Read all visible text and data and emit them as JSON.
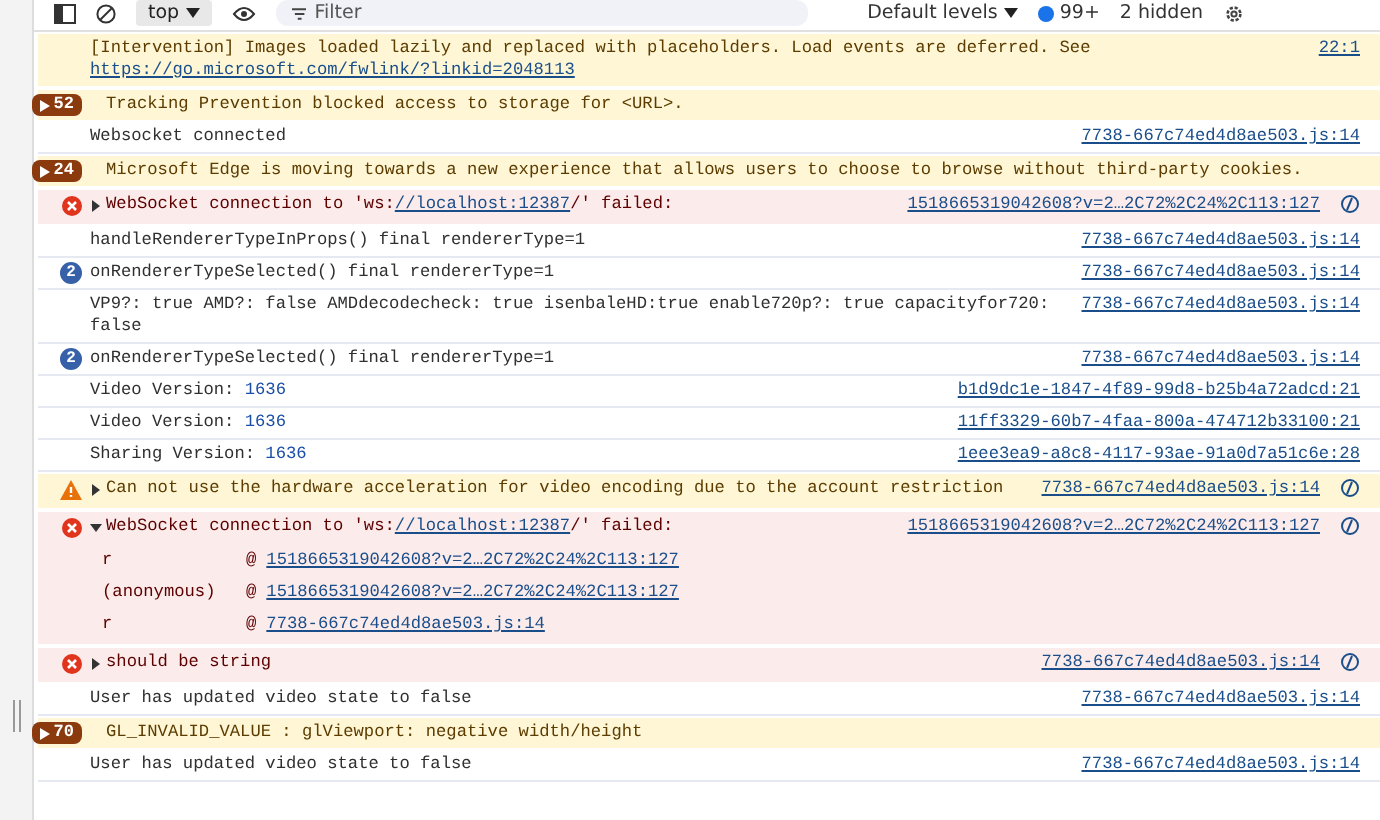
{
  "toolbar": {
    "context": "top",
    "filter": {
      "placeholder": "Filter"
    },
    "levels": "Default levels",
    "issues": "99+",
    "hidden": "2 hidden"
  },
  "messages": [
    {
      "kind": "warning",
      "parts": [
        {
          "kind": "text",
          "text": "[Intervention] Images loaded lazily and replaced with placeholders. Load events are deferred. See"
        },
        {
          "kind": "link_line",
          "text": "https://go.microsoft.com/fwlink/?linkid=2048113"
        }
      ],
      "source": "22:1",
      "insight": false
    },
    {
      "kind": "warning",
      "count": "52",
      "parts": [
        {
          "kind": "text",
          "text": "Tracking Prevention blocked access to storage for <URL>."
        }
      ],
      "insight": false
    },
    {
      "kind": "info",
      "parts": [
        {
          "kind": "text",
          "text": "Websocket connected"
        }
      ],
      "source": "7738-667c74ed4d8ae503.js:14",
      "insight": false
    },
    {
      "kind": "warning",
      "count": "24",
      "parts": [
        {
          "kind": "text",
          "text": "Microsoft Edge is moving towards a new experience that allows users to choose to browse without third-party cookies."
        }
      ],
      "insight": false
    },
    {
      "kind": "error",
      "expanded": false,
      "parts": [
        {
          "kind": "text",
          "text": "WebSocket connection to 'ws:"
        },
        {
          "kind": "link",
          "text": "//localhost:12387"
        },
        {
          "kind": "text",
          "text": "/' failed:"
        }
      ],
      "source": "1518665319042608?v=2…2C72%2C24%2C113:127",
      "insight": true
    },
    {
      "kind": "info",
      "parts": [
        {
          "kind": "text",
          "text": "handleRendererTypeInProps() final rendererType=1"
        }
      ],
      "source": "7738-667c74ed4d8ae503.js:14",
      "insight": false
    },
    {
      "kind": "info",
      "repeat": "2",
      "parts": [
        {
          "kind": "text",
          "text": "onRendererTypeSelected() final rendererType=1"
        }
      ],
      "source": "7738-667c74ed4d8ae503.js:14",
      "insight": false
    },
    {
      "kind": "info",
      "parts": [
        {
          "kind": "text",
          "text": "VP9?: true AMD?: false AMDdecodecheck: true isenbaleHD:true enable720p?: true capacityfor720: false"
        }
      ],
      "source": "7738-667c74ed4d8ae503.js:14",
      "insight": false
    },
    {
      "kind": "info",
      "repeat": "2",
      "parts": [
        {
          "kind": "text",
          "text": "onRendererTypeSelected() final rendererType=1"
        }
      ],
      "source": "7738-667c74ed4d8ae503.js:14",
      "insight": false
    },
    {
      "kind": "info",
      "parts": [
        {
          "kind": "text",
          "text": "Video Version: "
        },
        {
          "kind": "number",
          "text": "1636"
        }
      ],
      "source": "b1d9dc1e-1847-4f89-99d8-b25b4a72adcd:21",
      "insight": false
    },
    {
      "kind": "info",
      "parts": [
        {
          "kind": "text",
          "text": "Video Version: "
        },
        {
          "kind": "number",
          "text": "1636"
        }
      ],
      "source": "11ff3329-60b7-4faa-800a-474712b33100:21",
      "insight": false
    },
    {
      "kind": "info",
      "parts": [
        {
          "kind": "text",
          "text": "Sharing Version: "
        },
        {
          "kind": "number",
          "text": "1636"
        }
      ],
      "source": "1eee3ea9-a8c8-4117-93ae-91a0d7a51c6e:28",
      "insight": false
    },
    {
      "kind": "alert",
      "expanded": false,
      "parts": [
        {
          "kind": "text",
          "text": "Can not use the hardware acceleration for video encoding due to the account restriction"
        }
      ],
      "source": "7738-667c74ed4d8ae503.js:14",
      "insight": true
    },
    {
      "kind": "error",
      "expanded": true,
      "parts": [
        {
          "kind": "text",
          "text": "WebSocket connection to 'ws:"
        },
        {
          "kind": "link",
          "text": "//localhost:12387"
        },
        {
          "kind": "text",
          "text": "/' failed:"
        }
      ],
      "source": "1518665319042608?v=2…2C72%2C24%2C113:127",
      "insight": true,
      "stack": [
        {
          "function": "r",
          "separator": "@",
          "location": "1518665319042608?v=2…2C72%2C24%2C113:127"
        },
        {
          "function": "(anonymous)",
          "separator": "@",
          "location": "1518665319042608?v=2…2C72%2C24%2C113:127"
        },
        {
          "function": "r",
          "separator": "@",
          "location": "7738-667c74ed4d8ae503.js:14"
        }
      ]
    },
    {
      "kind": "error",
      "expanded": false,
      "parts": [
        {
          "kind": "text",
          "text": "should be string"
        }
      ],
      "source": "7738-667c74ed4d8ae503.js:14",
      "insight": true
    },
    {
      "kind": "info",
      "parts": [
        {
          "kind": "text",
          "text": "User has updated video state to false"
        }
      ],
      "source": "7738-667c74ed4d8ae503.js:14",
      "insight": false
    },
    {
      "kind": "warning",
      "count": "70",
      "parts": [
        {
          "kind": "text",
          "text": "GL_INVALID_VALUE : glViewport: negative width/height"
        }
      ],
      "insight": false
    },
    {
      "kind": "info",
      "parts": [
        {
          "kind": "text",
          "text": "User has updated video state to false"
        }
      ],
      "source": "7738-667c74ed4d8ae503.js:14",
      "insight": false
    }
  ]
}
